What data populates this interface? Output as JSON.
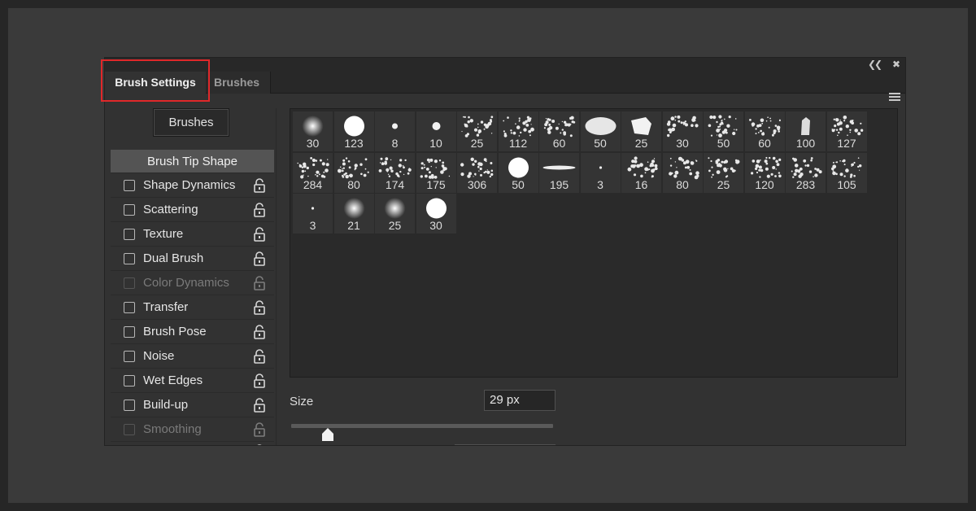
{
  "panel": {
    "tabs": [
      "Brush Settings",
      "Brushes"
    ],
    "brushes_button": "Brushes",
    "tip_shape_label": "Brush Tip Shape",
    "options": [
      {
        "label": "Shape Dynamics",
        "enabled": true
      },
      {
        "label": "Scattering",
        "enabled": true
      },
      {
        "label": "Texture",
        "enabled": true
      },
      {
        "label": "Dual Brush",
        "enabled": true
      },
      {
        "label": "Color Dynamics",
        "enabled": false
      },
      {
        "label": "Transfer",
        "enabled": true
      },
      {
        "label": "Brush Pose",
        "enabled": true
      },
      {
        "label": "Noise",
        "enabled": true
      },
      {
        "label": "Wet Edges",
        "enabled": true
      },
      {
        "label": "Build-up",
        "enabled": true
      },
      {
        "label": "Smoothing",
        "enabled": false
      }
    ],
    "brush_sizes": [
      "30",
      "123",
      "8",
      "10",
      "25",
      "112",
      "60",
      "50",
      "25",
      "30",
      "50",
      "60",
      "100",
      "127",
      "284",
      "80",
      "174",
      "175",
      "306",
      "50",
      "195",
      "3",
      "16",
      "80",
      "25",
      "120",
      "283",
      "105",
      "3",
      "21",
      "25",
      "30"
    ],
    "size": {
      "label": "Size",
      "value": "29 px"
    },
    "colors": {
      "highlight": "#e0282a",
      "panel": "#323232",
      "selected_row": "#545454"
    }
  }
}
